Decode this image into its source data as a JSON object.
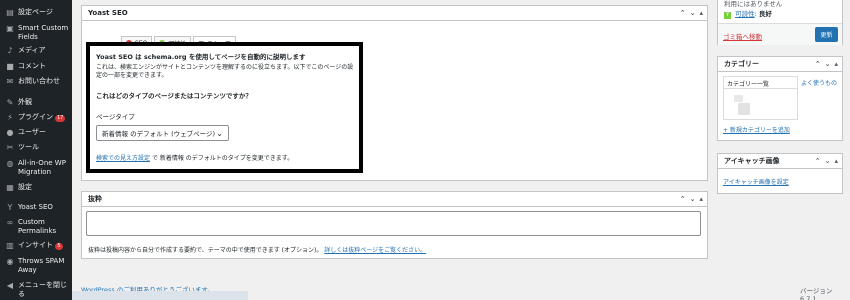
{
  "sidebar": {
    "items": [
      {
        "icon": "settings-page-icon",
        "glyph": "▤",
        "label": "設定ページ"
      },
      {
        "icon": "custom-fields-icon",
        "glyph": "▣",
        "label": "Smart Custom Fields"
      },
      {
        "icon": "media-icon",
        "glyph": "♪",
        "label": "メディア"
      },
      {
        "icon": "comments-icon",
        "glyph": "■",
        "label": "コメント"
      },
      {
        "icon": "contact-icon",
        "glyph": "✉",
        "label": "お問い合わせ"
      },
      {
        "icon": "appearance-icon",
        "glyph": "✎",
        "label": "外観"
      },
      {
        "icon": "plugins-icon",
        "glyph": "⚡",
        "label": "プラグイン",
        "badge": "17"
      },
      {
        "icon": "users-icon",
        "glyph": "●",
        "label": "ユーザー"
      },
      {
        "icon": "tools-icon",
        "glyph": "✂",
        "label": "ツール"
      },
      {
        "icon": "migration-icon",
        "glyph": "◍",
        "label": "All-in-One WP Migration"
      },
      {
        "icon": "settings-icon",
        "glyph": "▦",
        "label": "設定"
      },
      {
        "icon": "yoast-icon",
        "glyph": "Y",
        "label": "Yoast SEO"
      },
      {
        "icon": "permalinks-icon",
        "glyph": "∞",
        "label": "Custom Permalinks"
      },
      {
        "icon": "insights-icon",
        "glyph": "▥",
        "label": "インサイト",
        "badge": "5"
      },
      {
        "icon": "spam-icon",
        "glyph": "◉",
        "label": "Throws SPAM Away"
      },
      {
        "icon": "collapse-menu-icon",
        "glyph": "◀",
        "label": "メニューを閉じる"
      }
    ]
  },
  "yoast": {
    "title": "Yoast SEO",
    "tabs": [
      {
        "label": "SEO",
        "dot": "#dc3232"
      },
      {
        "label": "可読性",
        "dot": "#7ad03a"
      },
      {
        "label": "スキーマ"
      }
    ],
    "schema": {
      "heading": "Yoast SEO は schema.org を使用してページを自動的に説明します",
      "desc_line1": "これは、検索エンジンがサイトとコンテンツを理解するのに役立ちます。以下でこのページの設",
      "desc_line2": "定の一部を変更できます。",
      "question": "これはどのタイプのページまたはコンテンツですか？",
      "page_type_label": "ページタイプ",
      "page_type_value": "新着情報 のデフォルト (ウェブページ)",
      "footer_link": "検索での見え方設定",
      "footer_text": "で 新着情報 のデフォルトのタイプを変更できます。"
    }
  },
  "excerpt": {
    "title": "抜粋",
    "help_text": "抜粋は投稿内容から自分で作成する要約で、テーマの中で使用できます (オプション)。",
    "help_link": "詳しくは抜粋ページをご覧ください。"
  },
  "publish": {
    "partial_text": "利用にはありません",
    "readability_label": "可読性",
    "readability_value": "良好",
    "trash_link": "ゴミ箱へ移動",
    "update_button": "更新"
  },
  "categories": {
    "title": "カテゴリー",
    "tab_all": "カテゴリー一覧",
    "tab_popular": "よく使うもの",
    "add_link": "+ 新規カテゴリーを追加"
  },
  "featured_image": {
    "title": "アイキャッチ画像",
    "set_link": "アイキャッチ画像を設定"
  },
  "footer": {
    "left_text": "WordPress のご利用ありがとうございます。",
    "version": "バージョン 6.7.1"
  },
  "colors": {
    "sidebar_bg": "#1d2327",
    "accent": "#2271b1",
    "danger": "#d63638",
    "success": "#7ad03a"
  }
}
